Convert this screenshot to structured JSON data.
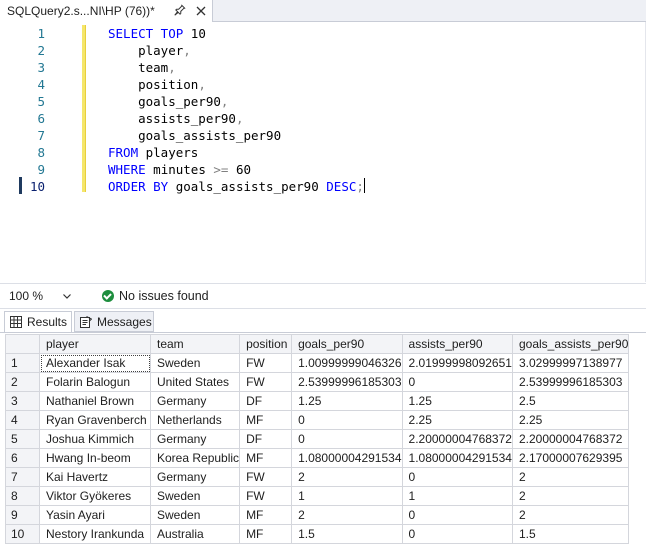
{
  "tab": {
    "title": "SQLQuery2.s...NI\\HP (76))*",
    "pin_icon": "pin-icon",
    "close_icon": "close-icon"
  },
  "editor": {
    "lines": [
      {
        "num": "1",
        "tokens": [
          {
            "t": "SELECT TOP ",
            "c": "kw"
          },
          {
            "t": "10",
            "c": "num"
          }
        ]
      },
      {
        "num": "2",
        "tokens": [
          {
            "t": "    player",
            "c": ""
          },
          {
            "t": ",",
            "c": "op"
          }
        ]
      },
      {
        "num": "3",
        "tokens": [
          {
            "t": "    team",
            "c": ""
          },
          {
            "t": ",",
            "c": "op"
          }
        ]
      },
      {
        "num": "4",
        "tokens": [
          {
            "t": "    position",
            "c": ""
          },
          {
            "t": ",",
            "c": "op"
          }
        ]
      },
      {
        "num": "5",
        "tokens": [
          {
            "t": "    goals_per90",
            "c": ""
          },
          {
            "t": ",",
            "c": "op"
          }
        ]
      },
      {
        "num": "6",
        "tokens": [
          {
            "t": "    assists_per90",
            "c": ""
          },
          {
            "t": ",",
            "c": "op"
          }
        ]
      },
      {
        "num": "7",
        "tokens": [
          {
            "t": "    goals_assists_per90",
            "c": ""
          }
        ]
      },
      {
        "num": "8",
        "tokens": [
          {
            "t": "FROM",
            "c": "kw"
          },
          {
            "t": " players",
            "c": ""
          }
        ]
      },
      {
        "num": "9",
        "tokens": [
          {
            "t": "WHERE",
            "c": "kw"
          },
          {
            "t": " minutes ",
            "c": ""
          },
          {
            "t": ">=",
            "c": "op"
          },
          {
            "t": " 60",
            "c": "num"
          }
        ]
      },
      {
        "num": "10",
        "tokens": [
          {
            "t": "ORDER BY",
            "c": "kw"
          },
          {
            "t": " goals_assists_per90 ",
            "c": ""
          },
          {
            "t": "DESC",
            "c": "kw"
          },
          {
            "t": ";",
            "c": "op"
          }
        ]
      }
    ]
  },
  "status": {
    "zoom": "100 %",
    "issues": "No issues found"
  },
  "results_tabs": {
    "results": "Results",
    "messages": "Messages"
  },
  "grid": {
    "columns": [
      "player",
      "team",
      "position",
      "goals_per90",
      "assists_per90",
      "goals_assists_per90"
    ],
    "rows": [
      [
        "1",
        "Alexander Isak",
        "Sweden",
        "FW",
        "1.00999999046326",
        "2.01999998092651",
        "3.02999997138977"
      ],
      [
        "2",
        "Folarin Balogun",
        "United States",
        "FW",
        "2.53999996185303",
        "0",
        "2.53999996185303"
      ],
      [
        "3",
        "Nathaniel Brown",
        "Germany",
        "DF",
        "1.25",
        "1.25",
        "2.5"
      ],
      [
        "4",
        "Ryan Gravenberch",
        "Netherlands",
        "MF",
        "0",
        "2.25",
        "2.25"
      ],
      [
        "5",
        "Joshua Kimmich",
        "Germany",
        "DF",
        "0",
        "2.20000004768372",
        "2.20000004768372"
      ],
      [
        "6",
        "Hwang In-beom",
        "Korea Republic",
        "MF",
        "1.08000004291534",
        "1.08000004291534",
        "2.17000007629395"
      ],
      [
        "7",
        "Kai Havertz",
        "Germany",
        "FW",
        "2",
        "0",
        "2"
      ],
      [
        "8",
        "Viktor Gyökeres",
        "Sweden",
        "FW",
        "1",
        "1",
        "2"
      ],
      [
        "9",
        "Yasin Ayari",
        "Sweden",
        "MF",
        "2",
        "0",
        "2"
      ],
      [
        "10",
        "Nestory Irankunda",
        "Australia",
        "MF",
        "1.5",
        "0",
        "1.5"
      ]
    ]
  }
}
